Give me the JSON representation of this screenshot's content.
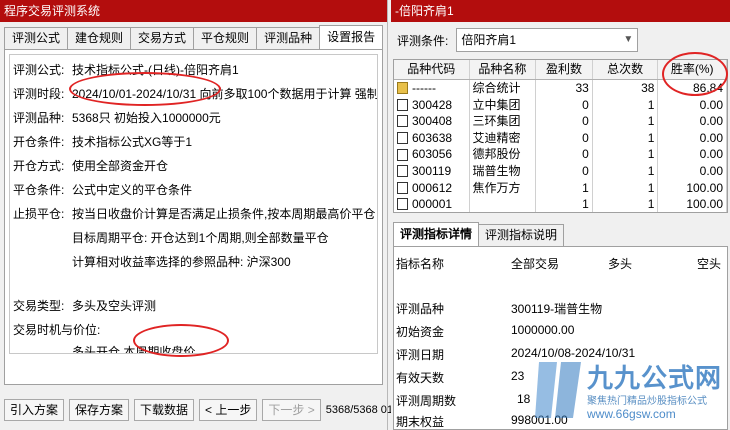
{
  "left": {
    "title": "程序交易评测系统",
    "tabs": [
      "评测公式",
      "建仓规则",
      "交易方式",
      "平仓规则",
      "评测品种",
      "设置报告"
    ],
    "active_tab": "设置报告",
    "report": {
      "formula_label": "评测公式:",
      "formula_value": "技术指标公式-(日线)-倍阳齐肩1",
      "period_label": "评测时段:",
      "period_value": "2024/10/01-2024/10/31 向前多取100个数据用于计算 强制",
      "symbols_label": "评测品种:",
      "symbols_value": "5368只 初始投入1000000元",
      "open_cond_label": "开仓条件:",
      "open_cond_value": "技术指标公式XG等于1",
      "open_method_label": "开仓方式:",
      "open_method_value": "使用全部资金开仓",
      "close_cond_label": "平仓条件:",
      "close_cond_value": "公式中定义的平仓条件",
      "stop_label": "止损平仓:",
      "stop_value": "按当日收盘价计算是否满足止损条件,按本周期最高价平仓",
      "target_value": "目标周期平仓:  开仓达到1个周期,则全部数量平仓",
      "benchmark_value": "计算相对收益率选择的参照品种:  沪深300",
      "trade_type_label": "交易类型:",
      "trade_type_value": "多头及空头评测",
      "timing_label": "交易时机与价位:",
      "timing_value": "多头开仓,本周期收盘价"
    },
    "buttons": {
      "import": "引入方案",
      "save": "保存方案",
      "download": "下载数据",
      "prev": "< 上一步",
      "next": "下一步 >"
    },
    "pager": "5368/5368 01"
  },
  "right": {
    "title": "-倍阳齐肩1",
    "cond_label": "评测条件:",
    "cond_value": "倍阳齐肩1",
    "grid_headers": [
      "品种代码",
      "品种名称",
      "盈利数",
      "总次数",
      "胜率(%)"
    ],
    "rows": [
      {
        "code": "------",
        "name": "综合统计",
        "profit": "33",
        "total": "38",
        "rate": "86.84",
        "folder": true
      },
      {
        "code": "300428",
        "name": "立中集团",
        "profit": "0",
        "total": "1",
        "rate": "0.00"
      },
      {
        "code": "300408",
        "name": "三环集团",
        "profit": "0",
        "total": "1",
        "rate": "0.00"
      },
      {
        "code": "603638",
        "name": "艾迪精密",
        "profit": "0",
        "total": "1",
        "rate": "0.00"
      },
      {
        "code": "603056",
        "name": "德邦股份",
        "profit": "0",
        "total": "1",
        "rate": "0.00"
      },
      {
        "code": "300119",
        "name": "瑞普生物",
        "profit": "0",
        "total": "1",
        "rate": "0.00"
      },
      {
        "code": "000612",
        "name": "焦作万方",
        "profit": "1",
        "total": "1",
        "rate": "100.00"
      },
      {
        "code": "000001",
        "name": "",
        "profit": "1",
        "total": "1",
        "rate": "100.00"
      }
    ],
    "detail_tabs": [
      "评测指标详情",
      "评测指标说明"
    ],
    "detail_headers": [
      "指标名称",
      "全部交易",
      "多头",
      "空头"
    ],
    "detail_rows": [
      {
        "name": "评测品种",
        "value": "300119-瑞普生物"
      },
      {
        "name": "初始资金",
        "value": "1000000.00"
      },
      {
        "name": "评测日期",
        "value": "2024/10/08-2024/10/31"
      },
      {
        "name": "有效天数",
        "value": "23"
      },
      {
        "name": "评测周期数",
        "value": "18"
      },
      {
        "name": "期末权益",
        "value": "998001.00"
      }
    ]
  },
  "watermark": {
    "brand": "九九公式网",
    "slogan": "聚焦热门精品炒股指标公式",
    "url": "www.66gsw.com"
  },
  "colors": {
    "titlebar": "#b30d0d",
    "annotation": "#e02424",
    "watermark": "#2f78c0"
  }
}
